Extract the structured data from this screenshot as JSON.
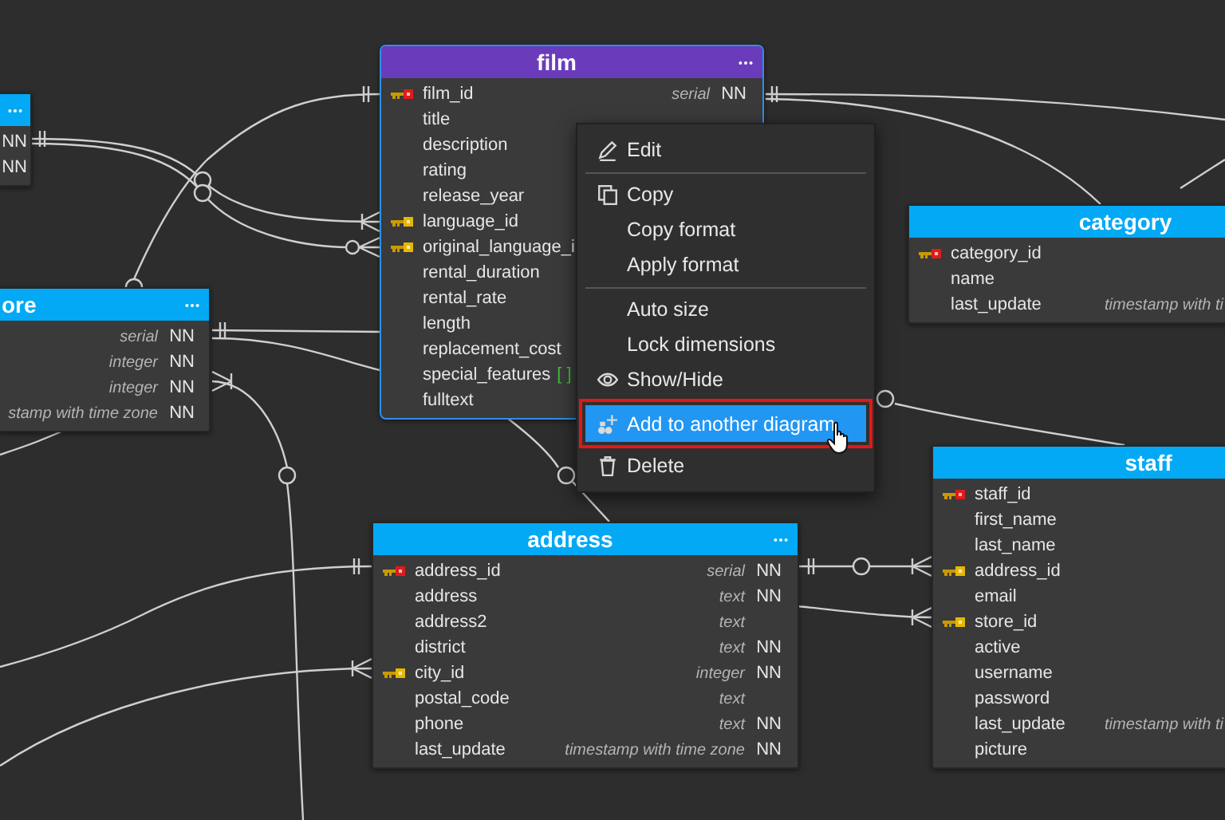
{
  "tables": [
    {
      "selected": false,
      "columns": [
        {
          "kind": "plain",
          "nn": "NN"
        },
        {
          "kind": "plain",
          "nn": "NN"
        }
      ]
    },
    {
      "title": "film",
      "selected": true,
      "columns": [
        {
          "name": "film_id",
          "kind": "primary",
          "type": "serial",
          "nn": "NN"
        },
        {
          "name": "title",
          "kind": "plain"
        },
        {
          "name": "description",
          "kind": "plain"
        },
        {
          "name": "rating",
          "kind": "plain"
        },
        {
          "name": "release_year",
          "kind": "plain"
        },
        {
          "name": "language_id",
          "kind": "foreign"
        },
        {
          "name": "original_language_i",
          "kind": "foreign"
        },
        {
          "name": "rental_duration",
          "kind": "plain"
        },
        {
          "name": "rental_rate",
          "kind": "plain"
        },
        {
          "name": "length",
          "kind": "plain"
        },
        {
          "name": "replacement_cost",
          "kind": "plain"
        },
        {
          "name": "special_features",
          "kind": "plain",
          "suffix": "[ ]"
        },
        {
          "name": "fulltext",
          "kind": "plain"
        }
      ]
    },
    {
      "title": "category",
      "selected": false,
      "columns": [
        {
          "name": "category_id",
          "kind": "primary"
        },
        {
          "name": "name",
          "kind": "plain"
        },
        {
          "name": "last_update",
          "kind": "plain",
          "type": "timestamp with ti"
        }
      ]
    },
    {
      "title": "ore",
      "selected": false,
      "columns": [
        {
          "kind": "plain",
          "type": "serial",
          "nn": "NN"
        },
        {
          "kind": "plain",
          "type": "integer",
          "nn": "NN"
        },
        {
          "kind": "plain",
          "type": "integer",
          "nn": "NN"
        },
        {
          "kind": "plain",
          "type": "stamp with time zone",
          "nn": "NN"
        }
      ]
    },
    {
      "title": "address",
      "selected": false,
      "columns": [
        {
          "name": "address_id",
          "kind": "primary",
          "type": "serial",
          "nn": "NN"
        },
        {
          "name": "address",
          "kind": "plain",
          "type": "text",
          "nn": "NN"
        },
        {
          "name": "address2",
          "kind": "plain",
          "type": "text"
        },
        {
          "name": "district",
          "kind": "plain",
          "type": "text",
          "nn": "NN"
        },
        {
          "name": "city_id",
          "kind": "foreign",
          "type": "integer",
          "nn": "NN"
        },
        {
          "name": "postal_code",
          "kind": "plain",
          "type": "text"
        },
        {
          "name": "phone",
          "kind": "plain",
          "type": "text",
          "nn": "NN"
        },
        {
          "name": "last_update",
          "kind": "plain",
          "type": "timestamp with time zone",
          "nn": "NN"
        }
      ]
    },
    {
      "title": "staff",
      "selected": false,
      "columns": [
        {
          "name": "staff_id",
          "kind": "primary"
        },
        {
          "name": "first_name",
          "kind": "plain"
        },
        {
          "name": "last_name",
          "kind": "plain"
        },
        {
          "name": "address_id",
          "kind": "foreign"
        },
        {
          "name": "email",
          "kind": "plain"
        },
        {
          "name": "store_id",
          "kind": "foreign"
        },
        {
          "name": "active",
          "kind": "plain"
        },
        {
          "name": "username",
          "kind": "plain"
        },
        {
          "name": "password",
          "kind": "plain"
        },
        {
          "name": "last_update",
          "kind": "plain",
          "type": "timestamp with ti"
        },
        {
          "name": "picture",
          "kind": "plain"
        }
      ]
    }
  ],
  "context_menu": {
    "items": [
      {
        "kind": "item",
        "label": "Edit",
        "selected": false
      },
      {
        "kind": "separator"
      },
      {
        "kind": "item",
        "label": "Copy",
        "selected": false
      },
      {
        "kind": "item",
        "label": "Copy format",
        "selected": false
      },
      {
        "kind": "item",
        "label": "Apply format",
        "selected": false
      },
      {
        "kind": "separator"
      },
      {
        "kind": "item",
        "label": "Auto size",
        "selected": false
      },
      {
        "kind": "item",
        "label": "Lock dimensions",
        "selected": false
      },
      {
        "kind": "item",
        "label": "Show/Hide",
        "selected": false
      },
      {
        "kind": "item",
        "label": "Add to another diagram",
        "selected": true
      },
      {
        "kind": "item",
        "label": "Delete",
        "selected": false
      }
    ]
  }
}
